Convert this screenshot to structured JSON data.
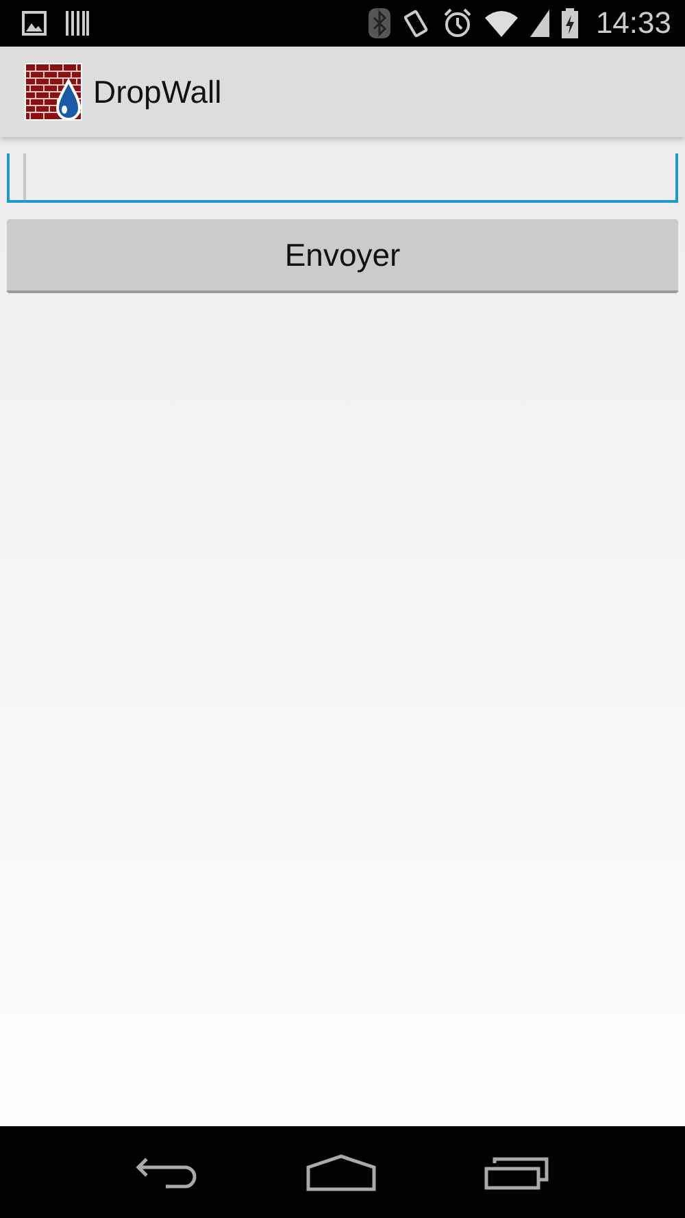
{
  "status_bar": {
    "time": "14:33"
  },
  "app_bar": {
    "title": "DropWall"
  },
  "message_field": {
    "focused": true
  },
  "send_button": {
    "label": "Envoyer"
  }
}
